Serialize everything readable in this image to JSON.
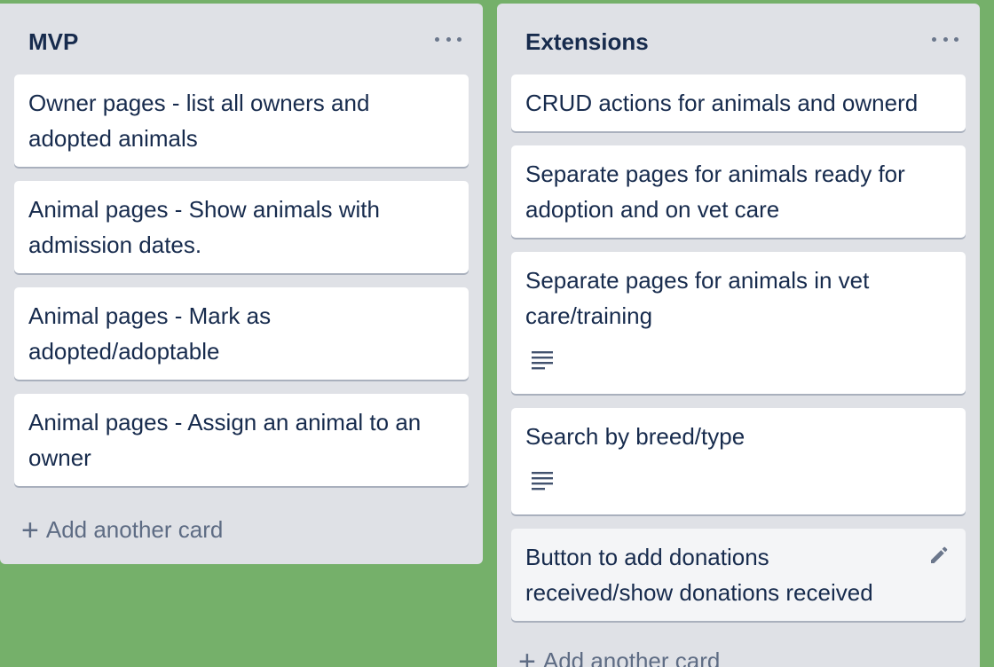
{
  "lists": [
    {
      "title": "MVP",
      "cards": [
        "Owner pages - list all owners and adopted animals",
        "Animal pages - Show animals with admission dates.",
        "Animal pages - Mark as adopted/adoptable",
        "Animal pages - Assign an animal to an owner"
      ],
      "add_card_label": "Add another card"
    },
    {
      "title": "Extensions",
      "cards": [
        "CRUD actions for animals and ownerd",
        "Separate pages for animals ready for adoption and on vet care",
        "Separate pages for animals in vet care/training",
        "Search by breed/type",
        "Button to add donations received/show donations received"
      ],
      "add_card_label": "Add another card"
    }
  ],
  "icons": {
    "list_menu": "more-horizontal-icon",
    "description": "description-icon",
    "edit": "pencil-icon",
    "add": "plus-icon"
  },
  "colors": {
    "board_background": "#75b06a",
    "list_background": "#dfe1e6",
    "card_background": "#ffffff",
    "text": "#172b4d",
    "muted": "#5e6c84"
  }
}
